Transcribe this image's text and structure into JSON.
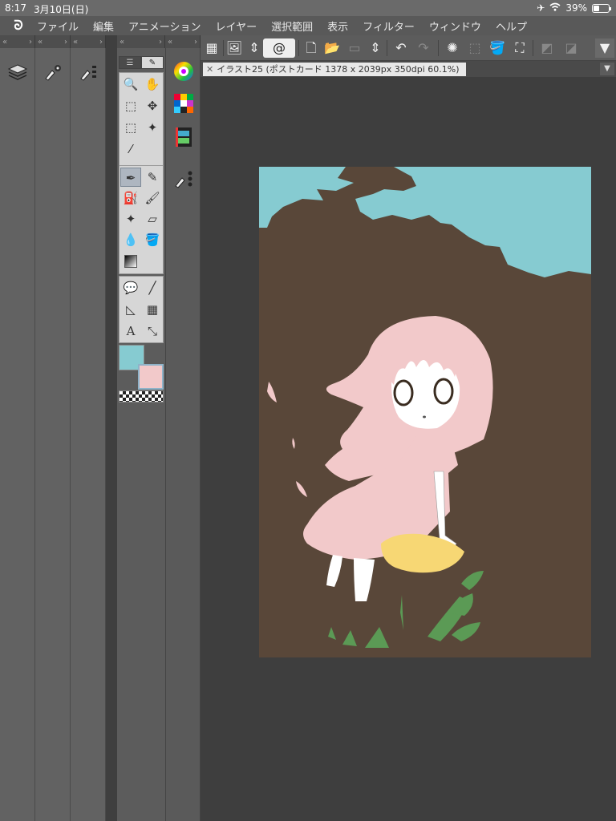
{
  "status": {
    "time": "8:17",
    "date": "3月10日(日)",
    "battery": "39%"
  },
  "menu": {
    "items": [
      "ファイル",
      "編集",
      "アニメーション",
      "レイヤー",
      "選択範囲",
      "表示",
      "フィルター",
      "ウィンドウ",
      "ヘルプ"
    ]
  },
  "document": {
    "tab_label": "イラスト25 (ポストカード 1378 x 2039px 350dpi 60.1%)"
  },
  "colors": {
    "main": "#86cbd1",
    "sub": "#f2c9ca",
    "background": "#594739",
    "sky": "#86cbd1",
    "hair": "#f2c9ca",
    "cushion": "#f7d774",
    "leaf": "#5b9a55"
  }
}
